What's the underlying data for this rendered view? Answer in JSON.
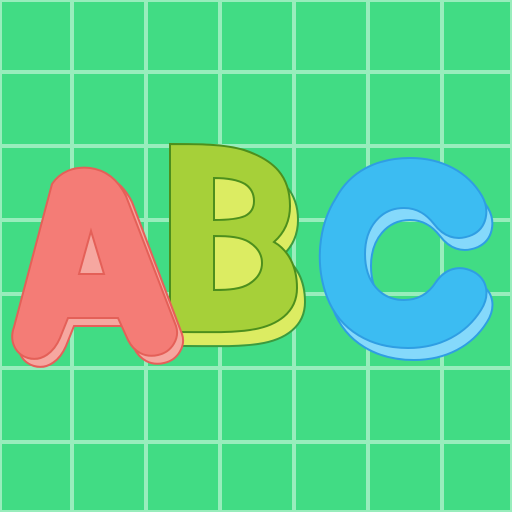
{
  "icon": {
    "letters": [
      "A",
      "B",
      "C"
    ],
    "colors": {
      "background": "#41dc84",
      "grid_line": "#a8f0c6",
      "letter_a_face": "#f47c76",
      "letter_a_side": "#f39d98",
      "letter_b_face": "#a4cf3a",
      "letter_b_side": "#d7ea63",
      "letter_c_face": "#3dbcf1",
      "letter_c_side": "#7ed4f8",
      "outline": "#3a8f2c"
    }
  }
}
